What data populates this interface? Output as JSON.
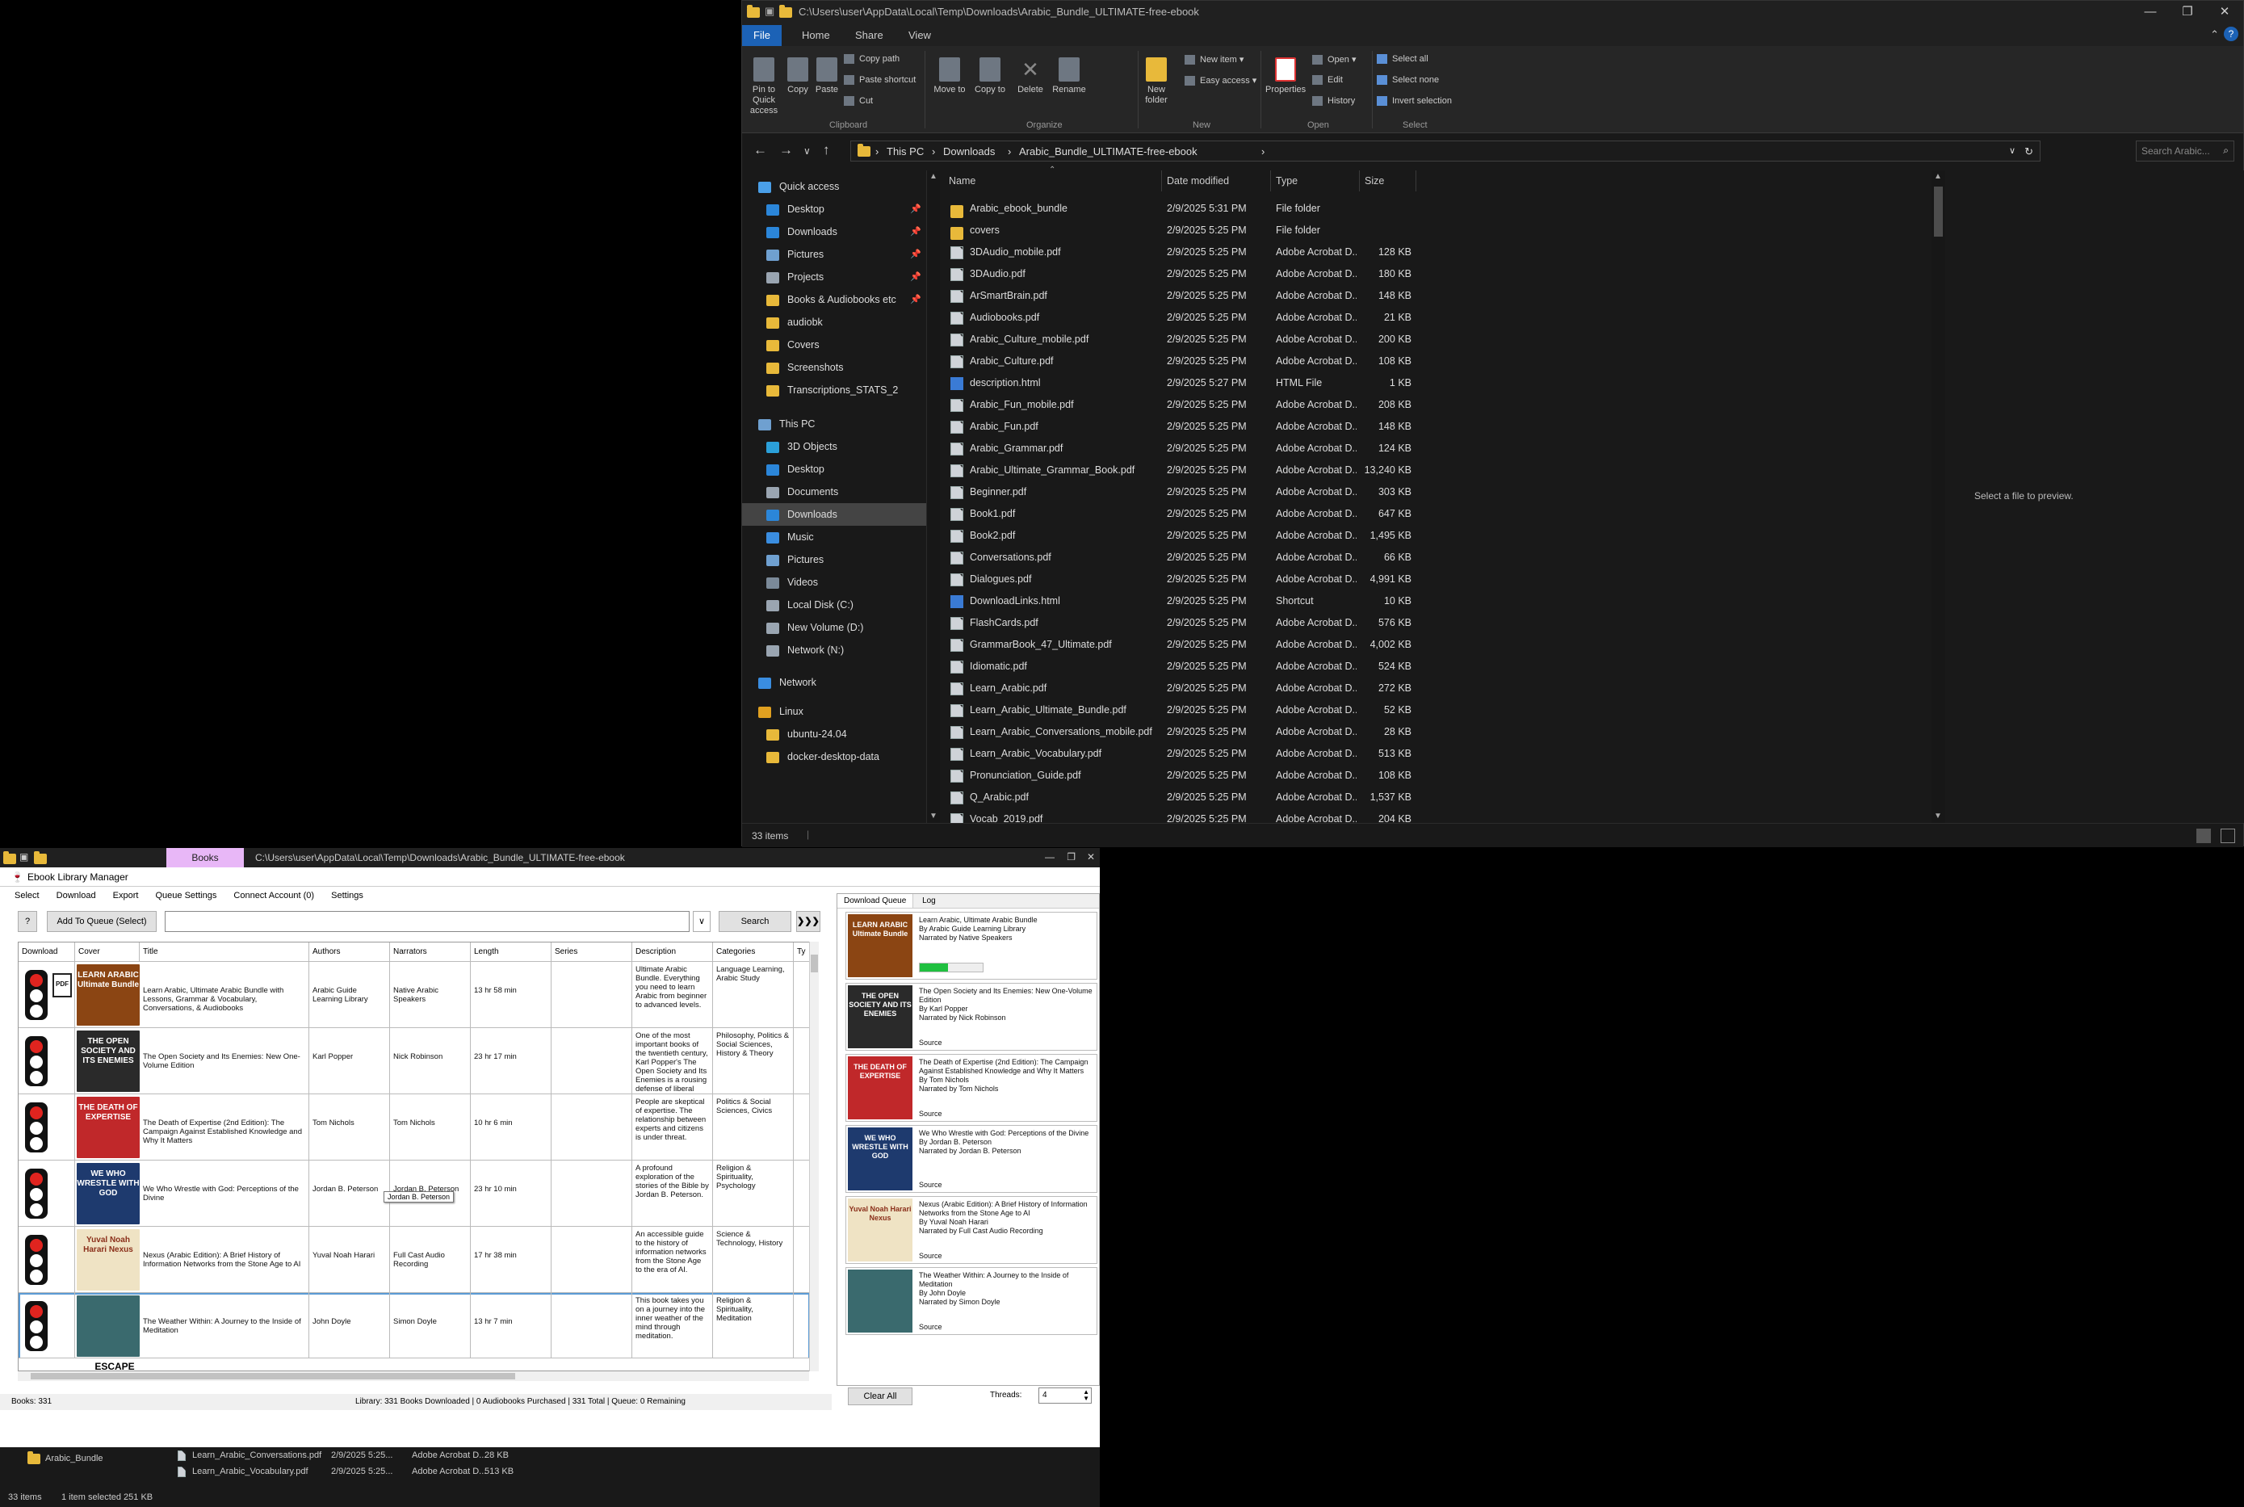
{
  "explorer": {
    "title": "C:\\Users\\user\\AppData\\Local\\Temp\\Downloads\\Arabic_Bundle_ULTIMATE-free-ebook",
    "tabs": [
      "File",
      "Home",
      "Share",
      "View"
    ],
    "ribbon": {
      "clipboard_buttons": [
        "Pin to Quick access",
        "Copy",
        "Paste"
      ],
      "clipboard_small": [
        "Copy path",
        "Paste shortcut",
        "Cut"
      ],
      "organize_buttons": [
        "Move to",
        "Copy to",
        "Delete",
        "Rename"
      ],
      "new_buttons": [
        "New folder"
      ],
      "new_small": [
        "New item",
        "Easy access"
      ],
      "open_buttons": [
        "Properties"
      ],
      "open_small": [
        "Open",
        "Edit",
        "History"
      ],
      "select_small": [
        "Select all",
        "Select none",
        "Invert selection"
      ],
      "groups": [
        "Clipboard",
        "Organize",
        "New",
        "Open",
        "Select"
      ]
    },
    "breadcrumb": [
      "This PC",
      "Downloads",
      "Arabic_Bundle_ULTIMATE-free-ebook"
    ],
    "search_placeholder": "Search Arabic...",
    "nav": [
      {
        "label": "Quick access",
        "icon": "star-icon",
        "pinned": false
      },
      {
        "label": "Desktop",
        "icon": "desktop-icon",
        "pinned": true
      },
      {
        "label": "Downloads",
        "icon": "download-icon",
        "pinned": true
      },
      {
        "label": "Pictures",
        "icon": "pictures-icon",
        "pinned": true
      },
      {
        "label": "Projects",
        "icon": "documents-icon",
        "pinned": true
      },
      {
        "label": "Books & Audiobooks etc",
        "icon": "folder-icon",
        "pinned": true
      },
      {
        "label": "audiobk",
        "icon": "folder-icon",
        "pinned": false
      },
      {
        "label": "Covers",
        "icon": "folder-icon",
        "pinned": false
      },
      {
        "label": "Screenshots",
        "icon": "folder-icon",
        "pinned": false
      },
      {
        "label": "Transcriptions_STATS_2",
        "icon": "folder-icon",
        "pinned": false
      },
      {
        "label": "This PC",
        "icon": "pc-icon",
        "pinned": false
      },
      {
        "label": "3D Objects",
        "icon": "cube-icon",
        "pinned": false
      },
      {
        "label": "Desktop",
        "icon": "desktop-icon",
        "pinned": false
      },
      {
        "label": "Documents",
        "icon": "documents-icon",
        "pinned": false
      },
      {
        "label": "Downloads",
        "icon": "download-icon",
        "pinned": false,
        "selected": true
      },
      {
        "label": "Music",
        "icon": "music-icon",
        "pinned": false
      },
      {
        "label": "Pictures",
        "icon": "pictures-icon",
        "pinned": false
      },
      {
        "label": "Videos",
        "icon": "video-icon",
        "pinned": false
      },
      {
        "label": "Local Disk (C:)",
        "icon": "drive-icon",
        "pinned": false
      },
      {
        "label": "New Volume (D:)",
        "icon": "drive-icon",
        "pinned": false
      },
      {
        "label": "Network (N:)",
        "icon": "drive-icon",
        "pinned": false
      },
      {
        "label": "Network",
        "icon": "network-icon",
        "pinned": false
      },
      {
        "label": "Linux",
        "icon": "linux-icon",
        "pinned": false
      },
      {
        "label": "ubuntu-24.04",
        "icon": "folder-icon",
        "pinned": false
      },
      {
        "label": "docker-desktop-data",
        "icon": "folder-icon",
        "pinned": false
      }
    ],
    "columns": [
      "Name",
      "Date modified",
      "Type",
      "Size"
    ],
    "files": [
      {
        "name": "Arabic_ebook_bundle",
        "date": "2/9/2025 5:31 PM",
        "type": "File folder",
        "size": "",
        "icon": "folder"
      },
      {
        "name": "covers",
        "date": "2/9/2025 5:25 PM",
        "type": "File folder",
        "size": "",
        "icon": "folder"
      },
      {
        "name": "3DAudio_mobile.pdf",
        "date": "2/9/2025 5:25 PM",
        "type": "Adobe Acrobat D...",
        "size": "128 KB",
        "icon": "doc"
      },
      {
        "name": "3DAudio.pdf",
        "date": "2/9/2025 5:25 PM",
        "type": "Adobe Acrobat D...",
        "size": "180 KB",
        "icon": "doc"
      },
      {
        "name": "ArSmartBrain.pdf",
        "date": "2/9/2025 5:25 PM",
        "type": "Adobe Acrobat D...",
        "size": "148 KB",
        "icon": "doc"
      },
      {
        "name": "Audiobooks.pdf",
        "date": "2/9/2025 5:25 PM",
        "type": "Adobe Acrobat D...",
        "size": "21 KB",
        "icon": "doc"
      },
      {
        "name": "Arabic_Culture_mobile.pdf",
        "date": "2/9/2025 5:25 PM",
        "type": "Adobe Acrobat D...",
        "size": "200 KB",
        "icon": "doc"
      },
      {
        "name": "Arabic_Culture.pdf",
        "date": "2/9/2025 5:25 PM",
        "type": "Adobe Acrobat D...",
        "size": "108 KB",
        "icon": "doc"
      },
      {
        "name": "description.html",
        "date": "2/9/2025 5:27 PM",
        "type": "HTML File",
        "size": "1 KB",
        "icon": "html"
      },
      {
        "name": "Arabic_Fun_mobile.pdf",
        "date": "2/9/2025 5:25 PM",
        "type": "Adobe Acrobat D...",
        "size": "208 KB",
        "icon": "doc"
      },
      {
        "name": "Arabic_Fun.pdf",
        "date": "2/9/2025 5:25 PM",
        "type": "Adobe Acrobat D...",
        "size": "148 KB",
        "icon": "doc"
      },
      {
        "name": "Arabic_Grammar.pdf",
        "date": "2/9/2025 5:25 PM",
        "type": "Adobe Acrobat D...",
        "size": "124 KB",
        "icon": "doc"
      },
      {
        "name": "Arabic_Ultimate_Grammar_Book.pdf",
        "date": "2/9/2025 5:25 PM",
        "type": "Adobe Acrobat D...",
        "size": "13,240 KB",
        "icon": "doc"
      },
      {
        "name": "Beginner.pdf",
        "date": "2/9/2025 5:25 PM",
        "type": "Adobe Acrobat D...",
        "size": "303 KB",
        "icon": "doc"
      },
      {
        "name": "Book1.pdf",
        "date": "2/9/2025 5:25 PM",
        "type": "Adobe Acrobat D...",
        "size": "647 KB",
        "icon": "doc"
      },
      {
        "name": "Book2.pdf",
        "date": "2/9/2025 5:25 PM",
        "type": "Adobe Acrobat D...",
        "size": "1,495 KB",
        "icon": "doc"
      },
      {
        "name": "Conversations.pdf",
        "date": "2/9/2025 5:25 PM",
        "type": "Adobe Acrobat D...",
        "size": "66 KB",
        "icon": "doc"
      },
      {
        "name": "Dialogues.pdf",
        "date": "2/9/2025 5:25 PM",
        "type": "Adobe Acrobat D...",
        "size": "4,991 KB",
        "icon": "doc"
      },
      {
        "name": "DownloadLinks.html",
        "date": "2/9/2025 5:25 PM",
        "type": "Shortcut",
        "size": "10 KB",
        "icon": "html"
      },
      {
        "name": "FlashCards.pdf",
        "date": "2/9/2025 5:25 PM",
        "type": "Adobe Acrobat D...",
        "size": "576 KB",
        "icon": "doc"
      },
      {
        "name": "GrammarBook_47_Ultimate.pdf",
        "date": "2/9/2025 5:25 PM",
        "type": "Adobe Acrobat D...",
        "size": "4,002 KB",
        "icon": "doc"
      },
      {
        "name": "Idiomatic.pdf",
        "date": "2/9/2025 5:25 PM",
        "type": "Adobe Acrobat D...",
        "size": "524 KB",
        "icon": "doc"
      },
      {
        "name": "Learn_Arabic.pdf",
        "date": "2/9/2025 5:25 PM",
        "type": "Adobe Acrobat D...",
        "size": "272 KB",
        "icon": "doc"
      },
      {
        "name": "Learn_Arabic_Ultimate_Bundle.pdf",
        "date": "2/9/2025 5:25 PM",
        "type": "Adobe Acrobat D...",
        "size": "52 KB",
        "icon": "doc"
      },
      {
        "name": "Learn_Arabic_Conversations_mobile.pdf",
        "date": "2/9/2025 5:25 PM",
        "type": "Adobe Acrobat D...",
        "size": "28 KB",
        "icon": "doc"
      },
      {
        "name": "Learn_Arabic_Vocabulary.pdf",
        "date": "2/9/2025 5:25 PM",
        "type": "Adobe Acrobat D...",
        "size": "513 KB",
        "icon": "doc"
      },
      {
        "name": "Pronunciation_Guide.pdf",
        "date": "2/9/2025 5:25 PM",
        "type": "Adobe Acrobat D...",
        "size": "108 KB",
        "icon": "doc"
      },
      {
        "name": "Q_Arabic.pdf",
        "date": "2/9/2025 5:25 PM",
        "type": "Adobe Acrobat D...",
        "size": "1,537 KB",
        "icon": "doc"
      },
      {
        "name": "Vocab_2019.pdf",
        "date": "2/9/2025 5:25 PM",
        "type": "Adobe Acrobat D...",
        "size": "204 KB",
        "icon": "doc"
      }
    ],
    "preview_text": "Select a file to preview.",
    "status": "33 items"
  },
  "app": {
    "window_title": "C:\\Users\\user\\AppData\\Local\\Temp\\Downloads\\Arabic_Bundle_ULTIMATE-free-ebook",
    "pink_tab": "Books",
    "app_title": "Ebook Library Manager",
    "menu": [
      "Select",
      "Download",
      "Export",
      "Queue Settings",
      "Connect Account (0)",
      "Settings"
    ],
    "toolbar": {
      "help_label": "?",
      "add_label": "Add To Queue (Select)",
      "dropdown_label": "∨",
      "search_label": "Search",
      "next_label": "❯❯❯"
    },
    "grid_columns": [
      "Download",
      "Cover",
      "Title",
      "Authors",
      "Narrators",
      "Length",
      "Series",
      "Description",
      "Categories",
      "Ty"
    ],
    "rows": [
      {
        "light": "red",
        "pdf": true,
        "cover_text": "LEARN ARABIC Ultimate Bundle",
        "cover_bg": "#8b4513",
        "title": "Learn Arabic, Ultimate Arabic Bundle with Lessons, Grammar & Vocabulary, Conversations, & Audiobooks",
        "authors": "Arabic Guide Learning Library",
        "narrators": "Native Arabic Speakers",
        "length": "13 hr 58 min",
        "series": "",
        "description": "Ultimate Arabic Bundle. Everything you need to learn Arabic from beginner to advanced levels.",
        "categories": "Language Learning, Arabic Study"
      },
      {
        "light": "red",
        "pdf": false,
        "cover_text": "THE OPEN SOCIETY AND ITS ENEMIES",
        "cover_bg": "#2a2a2a",
        "title": "The Open Society and Its Enemies: New One-Volume Edition",
        "authors": "Karl Popper",
        "narrators": "Nick Robinson",
        "length": "23 hr 17 min",
        "series": "",
        "description": "One of the most important books of the twentieth century, Karl Popper's The Open Society and Its Enemies is a rousing defense of liberal democracy.",
        "categories": "Philosophy, Politics & Social Sciences, History & Theory"
      },
      {
        "light": "red",
        "pdf": false,
        "cover_text": "THE DEATH OF EXPERTISE",
        "cover_bg": "#c0282a",
        "title": "The Death of Expertise (2nd Edition): The Campaign Against Established Knowledge and Why It Matters",
        "authors": "Tom Nichols",
        "narrators": "Tom Nichols",
        "length": "10 hr 6 min",
        "series": "",
        "description": "People are skeptical of expertise. The relationship between experts and citizens is under threat.",
        "categories": "Politics & Social Sciences, Civics"
      },
      {
        "light": "red",
        "pdf": false,
        "cover_text": "WE WHO WRESTLE WITH GOD",
        "cover_bg": "#1e3a6e",
        "title": "We Who Wrestle with God: Perceptions of the Divine",
        "authors": "Jordan B. Peterson",
        "narrators": "Jordan B. Peterson",
        "length": "23 hr 10 min",
        "series": "",
        "description": "A profound exploration of the stories of the Bible by Jordan B. Peterson.",
        "categories": "Religion & Spirituality, Psychology"
      },
      {
        "light": "red",
        "pdf": false,
        "cover_text": "Yuval Noah Harari Nexus",
        "cover_bg": "#efe3c4",
        "title": "Nexus (Arabic Edition): A Brief History of Information Networks from the Stone Age to AI",
        "authors": "Yuval Noah Harari",
        "narrators": "Full Cast Audio Recording",
        "length": "17 hr 38 min",
        "series": "",
        "description": "An accessible guide to the history of information networks from the Stone Age to the era of AI.",
        "categories": "Science & Technology, History"
      },
      {
        "light": "red",
        "pdf": false,
        "cover_text": "",
        "cover_bg": "#3a6a6e",
        "title": "The Weather Within: A Journey to the Inside of Meditation",
        "authors": "John Doyle",
        "narrators": "Simon Doyle",
        "length": "13 hr 7 min",
        "series": "",
        "description": "This book takes you on a journey into the inner weather of the mind through meditation.",
        "categories": "Religion & Spirituality, Meditation"
      }
    ],
    "partial_row_label": "ESCAPE",
    "tooltip": "Jordan B. Peterson",
    "status_left": "Books: 331",
    "status_main": "Library: 331 Books Downloaded | 0 Audiobooks Purchased | 331 Total | Queue: 0 Remaining",
    "queue": {
      "tabs": [
        "Download Queue",
        "Log"
      ],
      "items": [
        {
          "cover_text": "LEARN ARABIC Ultimate Bundle",
          "cover_bg": "#8b4513",
          "text": "Learn Arabic, Ultimate Arabic Bundle\nBy Arabic Guide Learning Library\nNarrated by Native Speakers",
          "source": "",
          "progress": 0.45
        },
        {
          "cover_text": "THE OPEN SOCIETY AND ITS ENEMIES",
          "cover_bg": "#2a2a2a",
          "text": "The Open Society and Its Enemies: New One-Volume Edition\nBy Karl Popper\nNarrated by Nick Robinson",
          "source": "Source",
          "progress": null
        },
        {
          "cover_text": "THE DEATH OF EXPERTISE",
          "cover_bg": "#c0282a",
          "text": "The Death of Expertise (2nd Edition): The Campaign Against Established Knowledge and Why It Matters\nBy Tom Nichols\nNarrated by Tom Nichols",
          "source": "Source",
          "progress": null
        },
        {
          "cover_text": "WE WHO WRESTLE WITH GOD",
          "cover_bg": "#1e3a6e",
          "text": "We Who Wrestle with God: Perceptions of the Divine\nBy Jordan B. Peterson\nNarrated by Jordan B. Peterson",
          "source": "Source",
          "progress": null
        },
        {
          "cover_text": "Yuval Noah Harari Nexus",
          "cover_bg": "#efe3c4",
          "text": "Nexus (Arabic Edition): A Brief History of Information Networks from the Stone Age to AI\nBy Yuval Noah Harari\nNarrated by Full Cast Audio Recording",
          "source": "Source",
          "progress": null
        },
        {
          "cover_text": "",
          "cover_bg": "#3a6a6e",
          "text": "The Weather Within: A Journey to the Inside of Meditation\nBy John Doyle\nNarrated by Simon Doyle",
          "source": "Source",
          "progress": null
        }
      ],
      "clear_label": "Clear All",
      "threads_label": "Threads:",
      "threads_value": "4"
    },
    "bg_explorer": {
      "folder": "Arabic_Bundle",
      "rows": [
        {
          "name": "Learn_Arabic_Conversations.pdf",
          "date": "2/9/2025 5:25...",
          "type": "Adobe Acrobat D...",
          "size": "28 KB"
        },
        {
          "name": "Learn_Arabic_Vocabulary.pdf",
          "date": "2/9/2025 5:25...",
          "type": "Adobe Acrobat D...",
          "size": "513 KB"
        }
      ],
      "status": "33 items",
      "status2": "1 item selected 251 KB"
    }
  }
}
